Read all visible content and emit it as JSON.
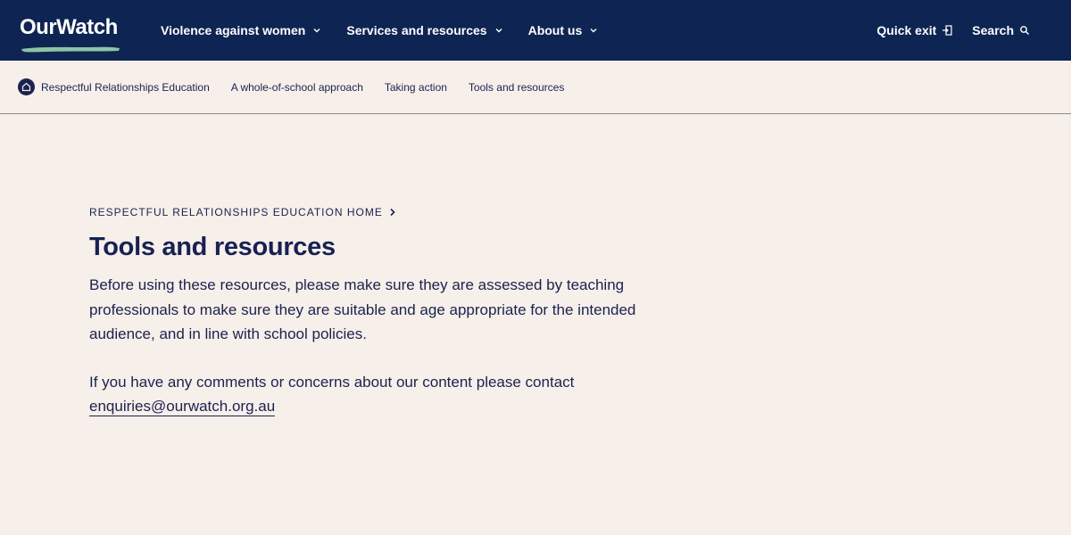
{
  "header": {
    "logo_text": "OurWatch",
    "nav": [
      {
        "label": "Violence against women"
      },
      {
        "label": "Services and resources"
      },
      {
        "label": "About us"
      }
    ],
    "quick_exit_label": "Quick exit",
    "search_label": "Search"
  },
  "subnav": {
    "home_label": "Respectful Relationships Education",
    "links": [
      {
        "label": "A whole-of-school approach"
      },
      {
        "label": "Taking action"
      },
      {
        "label": "Tools and resources"
      }
    ]
  },
  "main": {
    "breadcrumb": "RESPECTFUL RELATIONSHIPS EDUCATION HOME",
    "title": "Tools and resources",
    "paragraph1": "Before using these resources, please make sure they are assessed by teaching professionals to make sure they are suitable and age appropriate for the intended audience, and in line with school policies.",
    "paragraph2_text": "If you have any comments or concerns about our content please contact",
    "email": "enquiries@ourwatch.org.au"
  },
  "colors": {
    "header_bg": "#0e2453",
    "page_bg": "#f7efe9",
    "text": "#1a2250",
    "logo_accent": "#8fc3a6"
  }
}
